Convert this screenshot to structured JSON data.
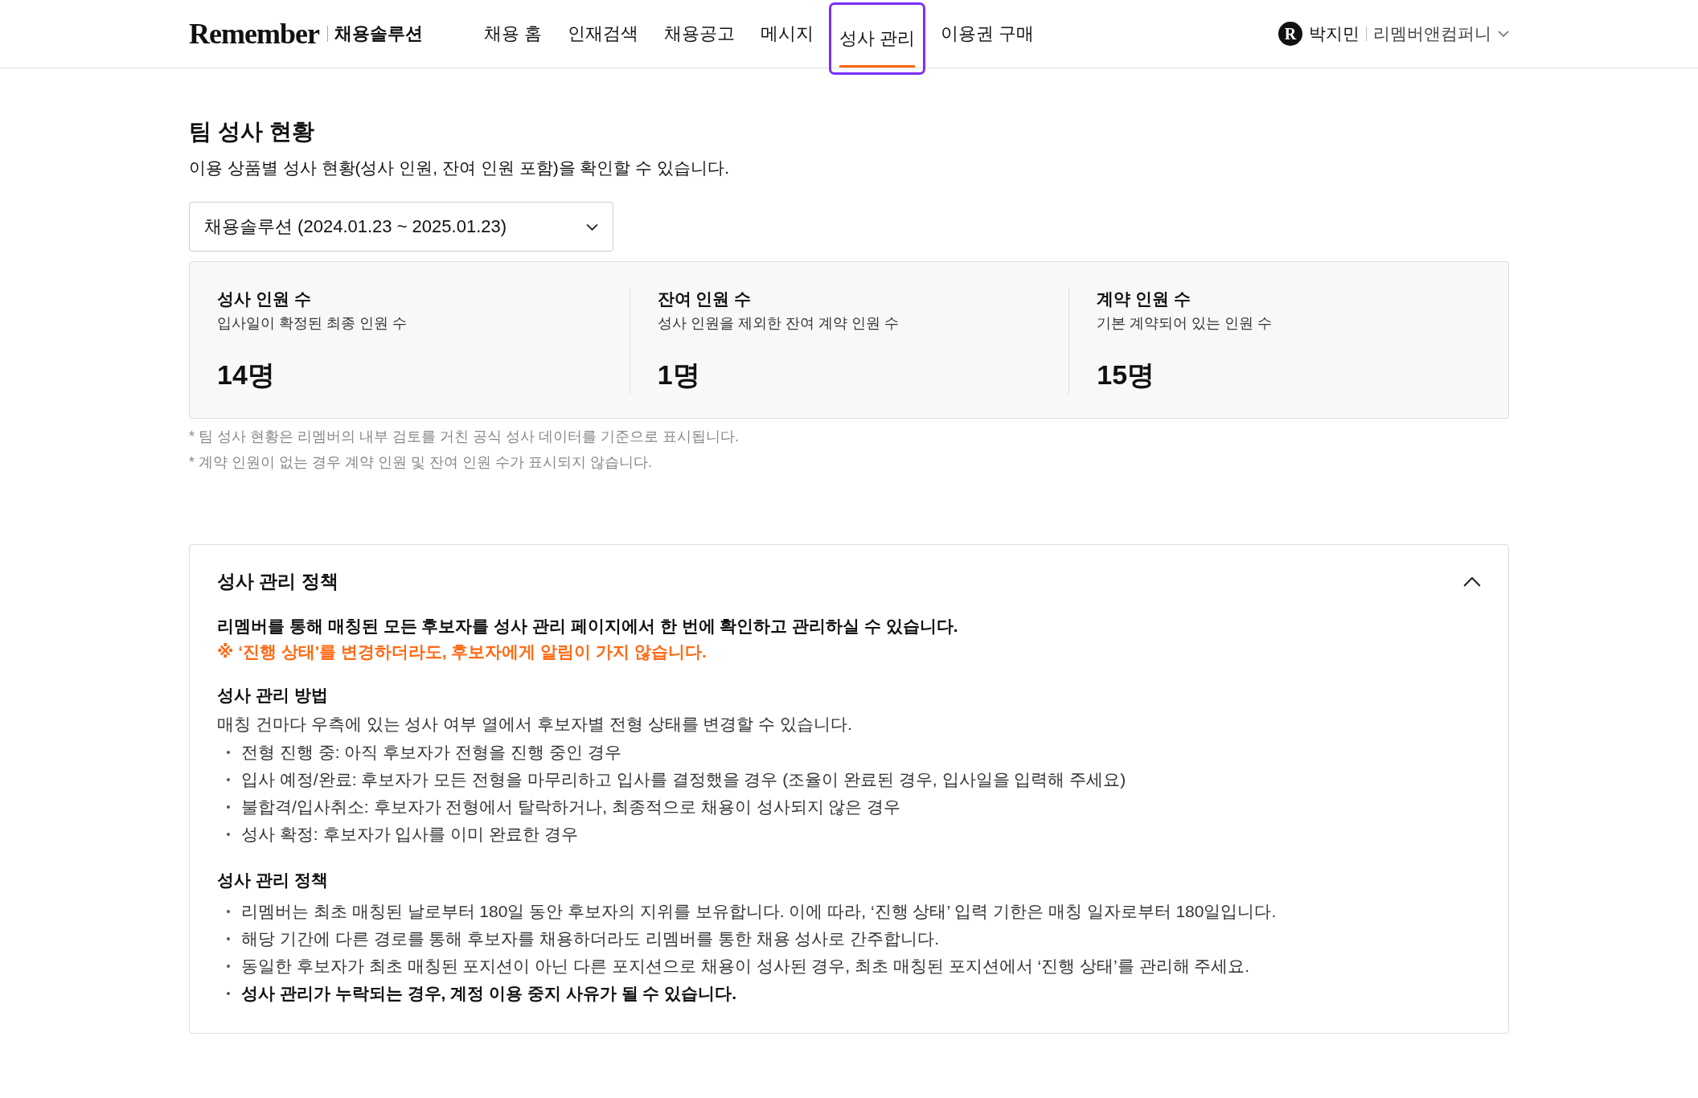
{
  "header": {
    "logo": "Remember",
    "product": "채용솔루션",
    "nav": [
      {
        "label": "채용 홈",
        "selected": false,
        "focused": false
      },
      {
        "label": "인재검색",
        "selected": false,
        "focused": false
      },
      {
        "label": "채용공고",
        "selected": false,
        "focused": false
      },
      {
        "label": "메시지",
        "selected": false,
        "focused": false
      },
      {
        "label": "성사 관리",
        "selected": true,
        "focused": true
      },
      {
        "label": "이용권 구매",
        "selected": false,
        "focused": false
      }
    ],
    "user": {
      "avatar_letter": "R",
      "name": "박지민",
      "company": "리멤버앤컴퍼니"
    }
  },
  "summary": {
    "title": "팀 성사 현황",
    "description": "이용 상품별 성사 현황(성사 인원, 잔여 인원 포함)을 확인할 수 있습니다.",
    "product_select": {
      "value": "채용솔루션 (2024.01.23 ~ 2025.01.23)"
    },
    "stats": [
      {
        "label": "성사 인원 수",
        "description": "입사일이 확정된 최종 인원 수",
        "value": "14명"
      },
      {
        "label": "잔여 인원 수",
        "description": "성사 인원을 제외한 잔여 계약 인원 수",
        "value": "1명"
      },
      {
        "label": "계약 인원 수",
        "description": "기본 계약되어 있는 인원 수",
        "value": "15명"
      }
    ],
    "notes": [
      "* 팀 성사 현황은 리멤버의 내부 검토를 거친 공식 성사 데이터를 기준으로 표시됩니다.",
      "* 계약 인원이 없는 경우 계약 인원 및 잔여 인원 수가 표시되지 않습니다."
    ]
  },
  "policy": {
    "title": "성사 관리 정책",
    "expanded": true,
    "intro": [
      {
        "kind": "strong",
        "text": "리멤버를 통해 매칭된 모든 후보자를 성사 관리 페이지에서 한 번에 확인하고 관리하실 수 있습니다."
      },
      {
        "kind": "warning",
        "text": "※ ‘진행 상태'를 변경하더라도, 후보자에게 알림이 가지 않습니다."
      }
    ],
    "sections": [
      {
        "heading": "성사 관리 방법",
        "description": "매칭 건마다 우측에 있는 성사 여부 열에서 후보자별 전형 상태를 변경할 수 있습니다.",
        "bullets": [
          {
            "text": "전형 진행 중: 아직 후보자가 전형을 진행 중인 경우",
            "bold": false
          },
          {
            "text": "입사 예정/완료: 후보자가 모든 전형을 마무리하고 입사를 결정했을 경우 (조율이 완료된 경우, 입사일을 입력해 주세요)",
            "bold": false
          },
          {
            "text": "불합격/입사취소: 후보자가 전형에서 탈락하거나, 최종적으로 채용이 성사되지 않은 경우",
            "bold": false
          },
          {
            "text": "성사 확정: 후보자가 입사를 이미 완료한 경우",
            "bold": false
          }
        ]
      },
      {
        "heading": "성사 관리 정책",
        "bullets": [
          {
            "text": "리멤버는 최초 매칭된 날로부터 180일 동안 후보자의 지위를 보유합니다. 이에 따라, ‘진행 상태’ 입력 기한은 매칭 일자로부터 180일입니다.",
            "bold": false
          },
          {
            "text": "해당 기간에 다른 경로를 통해 후보자를 채용하더라도 리멤버를 통한 채용 성사로 간주합니다.",
            "bold": false
          },
          {
            "text": "동일한 후보자가 최초 매칭된 포지션이 아닌 다른 포지션으로 채용이 성사된 경우, 최초 매칭된 포지션에서 ‘진행 상태’를 관리해 주세요.",
            "bold": false
          },
          {
            "text": "성사 관리가 누락되는 경우, 계정 이용 중지 사유가 될 수 있습니다.",
            "bold": true
          }
        ]
      }
    ]
  }
}
